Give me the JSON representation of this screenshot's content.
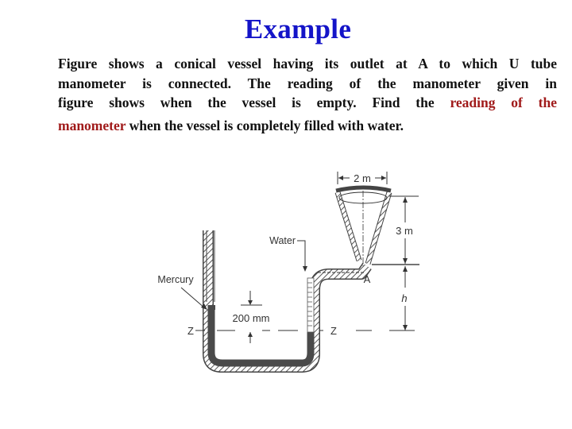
{
  "slide": {
    "title": "Example",
    "paragraph": {
      "line1": "Figure shows a conical vessel having its outlet at A to which U tube",
      "line2": "manometer is connected. The reading of the manometer given in",
      "line3_a": "figure shows when the vessel is empty. Find the ",
      "line3_b": "reading of the",
      "line4_a": "manometer",
      "line4_b": " when the vessel is completely filled with water."
    },
    "colors": {
      "title": "#1414c8",
      "body_text": "#111111",
      "highlight": "#a01a1a"
    }
  },
  "figure": {
    "labels": {
      "top_width": "2 m",
      "cone_height": "3 m",
      "water": "Water",
      "mercury": "Mercury",
      "outlet": "A",
      "height_var": "h",
      "mercury_diff": "200 mm",
      "datum_left": "Z",
      "datum_right": "Z"
    }
  }
}
